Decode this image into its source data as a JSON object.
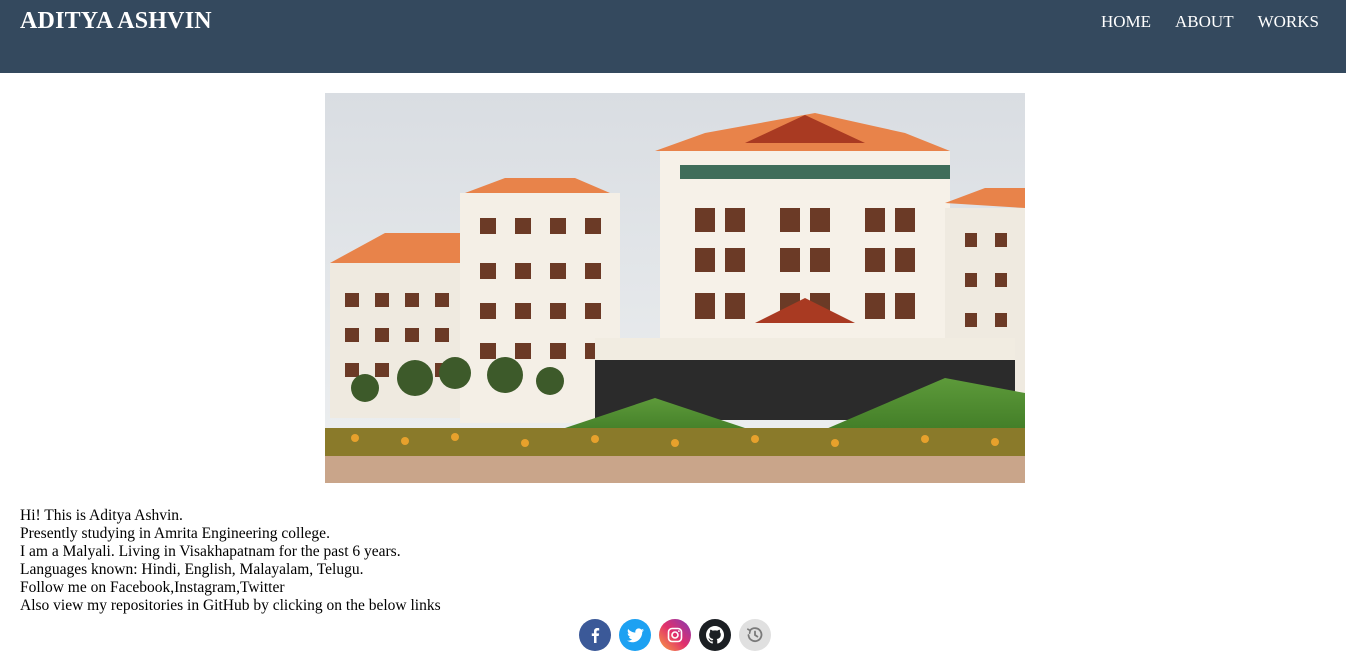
{
  "header": {
    "brand": "ADITYA ASHVIN",
    "nav": [
      {
        "label": "HOME"
      },
      {
        "label": "ABOUT"
      },
      {
        "label": "WORKS"
      }
    ],
    "background_color": "#34495e"
  },
  "bio": {
    "lines": [
      "Hi! This is Aditya Ashvin.",
      "Presently studying in Amrita Engineering college.",
      "I am a Malyali. Living in Visakhapatnam for the past 6 years.",
      "Languages known: Hindi, English, Malayalam, Telugu.",
      "Follow me on Facebook,Instagram,Twitter",
      "Also view my repositories in GitHub by clicking on the below links"
    ]
  },
  "socials": [
    {
      "icon": "facebook-icon",
      "color": "#3b5998"
    },
    {
      "icon": "twitter-icon",
      "color": "#1da1f2"
    },
    {
      "icon": "instagram-icon",
      "color": "#c13584"
    },
    {
      "icon": "github-icon",
      "color": "#1b1f23"
    },
    {
      "icon": "history-icon",
      "color": "#e0e0e0"
    }
  ]
}
